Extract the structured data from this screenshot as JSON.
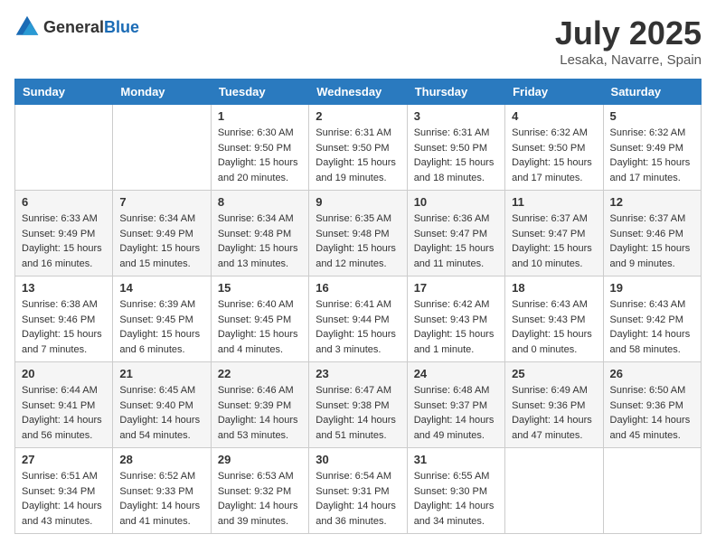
{
  "logo": {
    "general": "General",
    "blue": "Blue"
  },
  "header": {
    "month": "July 2025",
    "location": "Lesaka, Navarre, Spain"
  },
  "weekdays": [
    "Sunday",
    "Monday",
    "Tuesday",
    "Wednesday",
    "Thursday",
    "Friday",
    "Saturday"
  ],
  "weeks": [
    [
      {
        "day": "",
        "info": ""
      },
      {
        "day": "",
        "info": ""
      },
      {
        "day": "1",
        "info": "Sunrise: 6:30 AM\nSunset: 9:50 PM\nDaylight: 15 hours and 20 minutes."
      },
      {
        "day": "2",
        "info": "Sunrise: 6:31 AM\nSunset: 9:50 PM\nDaylight: 15 hours and 19 minutes."
      },
      {
        "day": "3",
        "info": "Sunrise: 6:31 AM\nSunset: 9:50 PM\nDaylight: 15 hours and 18 minutes."
      },
      {
        "day": "4",
        "info": "Sunrise: 6:32 AM\nSunset: 9:50 PM\nDaylight: 15 hours and 17 minutes."
      },
      {
        "day": "5",
        "info": "Sunrise: 6:32 AM\nSunset: 9:49 PM\nDaylight: 15 hours and 17 minutes."
      }
    ],
    [
      {
        "day": "6",
        "info": "Sunrise: 6:33 AM\nSunset: 9:49 PM\nDaylight: 15 hours and 16 minutes."
      },
      {
        "day": "7",
        "info": "Sunrise: 6:34 AM\nSunset: 9:49 PM\nDaylight: 15 hours and 15 minutes."
      },
      {
        "day": "8",
        "info": "Sunrise: 6:34 AM\nSunset: 9:48 PM\nDaylight: 15 hours and 13 minutes."
      },
      {
        "day": "9",
        "info": "Sunrise: 6:35 AM\nSunset: 9:48 PM\nDaylight: 15 hours and 12 minutes."
      },
      {
        "day": "10",
        "info": "Sunrise: 6:36 AM\nSunset: 9:47 PM\nDaylight: 15 hours and 11 minutes."
      },
      {
        "day": "11",
        "info": "Sunrise: 6:37 AM\nSunset: 9:47 PM\nDaylight: 15 hours and 10 minutes."
      },
      {
        "day": "12",
        "info": "Sunrise: 6:37 AM\nSunset: 9:46 PM\nDaylight: 15 hours and 9 minutes."
      }
    ],
    [
      {
        "day": "13",
        "info": "Sunrise: 6:38 AM\nSunset: 9:46 PM\nDaylight: 15 hours and 7 minutes."
      },
      {
        "day": "14",
        "info": "Sunrise: 6:39 AM\nSunset: 9:45 PM\nDaylight: 15 hours and 6 minutes."
      },
      {
        "day": "15",
        "info": "Sunrise: 6:40 AM\nSunset: 9:45 PM\nDaylight: 15 hours and 4 minutes."
      },
      {
        "day": "16",
        "info": "Sunrise: 6:41 AM\nSunset: 9:44 PM\nDaylight: 15 hours and 3 minutes."
      },
      {
        "day": "17",
        "info": "Sunrise: 6:42 AM\nSunset: 9:43 PM\nDaylight: 15 hours and 1 minute."
      },
      {
        "day": "18",
        "info": "Sunrise: 6:43 AM\nSunset: 9:43 PM\nDaylight: 15 hours and 0 minutes."
      },
      {
        "day": "19",
        "info": "Sunrise: 6:43 AM\nSunset: 9:42 PM\nDaylight: 14 hours and 58 minutes."
      }
    ],
    [
      {
        "day": "20",
        "info": "Sunrise: 6:44 AM\nSunset: 9:41 PM\nDaylight: 14 hours and 56 minutes."
      },
      {
        "day": "21",
        "info": "Sunrise: 6:45 AM\nSunset: 9:40 PM\nDaylight: 14 hours and 54 minutes."
      },
      {
        "day": "22",
        "info": "Sunrise: 6:46 AM\nSunset: 9:39 PM\nDaylight: 14 hours and 53 minutes."
      },
      {
        "day": "23",
        "info": "Sunrise: 6:47 AM\nSunset: 9:38 PM\nDaylight: 14 hours and 51 minutes."
      },
      {
        "day": "24",
        "info": "Sunrise: 6:48 AM\nSunset: 9:37 PM\nDaylight: 14 hours and 49 minutes."
      },
      {
        "day": "25",
        "info": "Sunrise: 6:49 AM\nSunset: 9:36 PM\nDaylight: 14 hours and 47 minutes."
      },
      {
        "day": "26",
        "info": "Sunrise: 6:50 AM\nSunset: 9:36 PM\nDaylight: 14 hours and 45 minutes."
      }
    ],
    [
      {
        "day": "27",
        "info": "Sunrise: 6:51 AM\nSunset: 9:34 PM\nDaylight: 14 hours and 43 minutes."
      },
      {
        "day": "28",
        "info": "Sunrise: 6:52 AM\nSunset: 9:33 PM\nDaylight: 14 hours and 41 minutes."
      },
      {
        "day": "29",
        "info": "Sunrise: 6:53 AM\nSunset: 9:32 PM\nDaylight: 14 hours and 39 minutes."
      },
      {
        "day": "30",
        "info": "Sunrise: 6:54 AM\nSunset: 9:31 PM\nDaylight: 14 hours and 36 minutes."
      },
      {
        "day": "31",
        "info": "Sunrise: 6:55 AM\nSunset: 9:30 PM\nDaylight: 14 hours and 34 minutes."
      },
      {
        "day": "",
        "info": ""
      },
      {
        "day": "",
        "info": ""
      }
    ]
  ]
}
